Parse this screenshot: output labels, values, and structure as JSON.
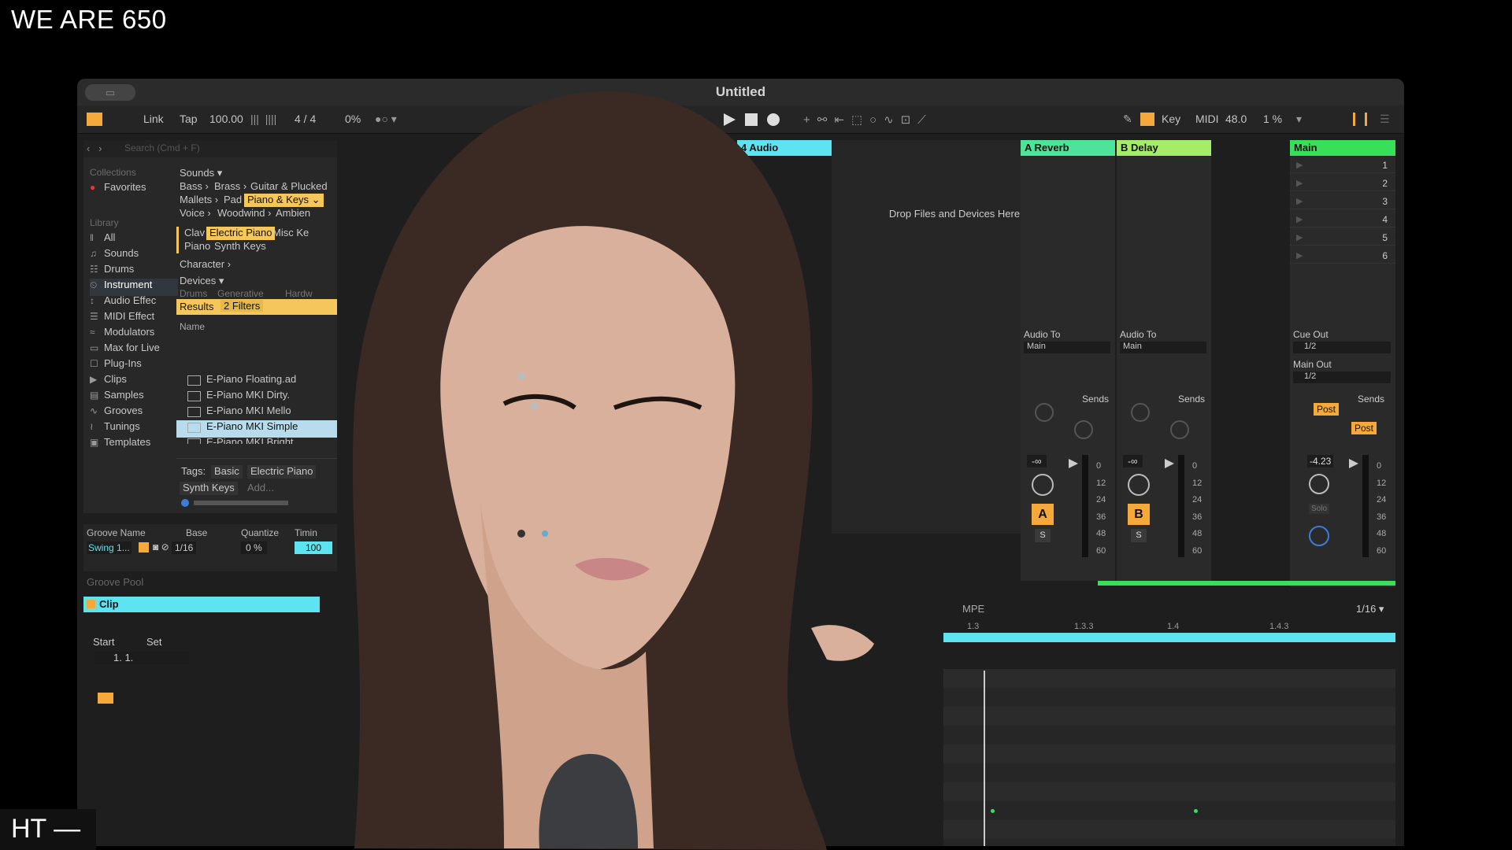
{
  "overlay": {
    "stream_title": "WE ARE 650",
    "corner_label": "HT —"
  },
  "window": {
    "title": "Untitled"
  },
  "controls": {
    "link": "Link",
    "tap": "Tap",
    "tempo": "100.00",
    "time_sig": "4  /  4",
    "groove_pct": "0%",
    "bar_readout": "4",
    "key": "Key",
    "midi": "MIDI",
    "cpu": "48.0",
    "cpu_pct": "1 %"
  },
  "browser": {
    "search_placeholder": "Search (Cmd + F)",
    "collections_label": "Collections",
    "favorites": "Favorites",
    "library_label": "Library",
    "library_items": [
      {
        "icon": "all-icon",
        "glyph": "‖",
        "label": "All"
      },
      {
        "icon": "sounds-icon",
        "glyph": "♫",
        "label": "Sounds"
      },
      {
        "icon": "drums-icon",
        "glyph": "☷",
        "label": "Drums"
      },
      {
        "icon": "instruments-icon",
        "glyph": "⏲",
        "label": "Instrument"
      },
      {
        "icon": "audio-effects-icon",
        "glyph": "↕",
        "label": "Audio Effec"
      },
      {
        "icon": "midi-effects-icon",
        "glyph": "☰",
        "label": "MIDI Effect"
      },
      {
        "icon": "modulators-icon",
        "glyph": "≈",
        "label": "Modulators"
      },
      {
        "icon": "max-for-live-icon",
        "glyph": "▭",
        "label": "Max for Live"
      },
      {
        "icon": "plug-ins-icon",
        "glyph": "☐",
        "label": "Plug-Ins"
      },
      {
        "icon": "clips-icon",
        "glyph": "▶",
        "label": "Clips"
      },
      {
        "icon": "samples-icon",
        "glyph": "▤",
        "label": "Samples"
      },
      {
        "icon": "grooves-icon",
        "glyph": "∿",
        "label": "Grooves"
      },
      {
        "icon": "tunings-icon",
        "glyph": "≀",
        "label": "Tunings"
      },
      {
        "icon": "templates-icon",
        "glyph": "▣",
        "label": "Templates"
      }
    ],
    "sounds_label": "Sounds ▾",
    "sound_cats": {
      "r1": [
        "Bass ›",
        "Brass ›",
        "Guitar & Plucked"
      ],
      "r2": [
        "Mallets ›",
        "Pad",
        "Piano & Keys ⌄"
      ],
      "r3": [
        "Voice ›",
        "Woodwind ›",
        "Ambien"
      ],
      "r4": [
        "Clav",
        "Electric Piano",
        "Misc Ke"
      ],
      "r5": [
        "Piano",
        "Synth Keys"
      ]
    },
    "character_label": "Character ›",
    "devices_label": "Devices ▾",
    "devices_sub": [
      "Drums",
      "Generative",
      "Hardw"
    ],
    "results_label": "Results",
    "filters_label": "2 Filters",
    "name_col": "Name",
    "results": [
      "E-Piano Floating.ad",
      "E-Piano MKI Dirty.",
      "E-Piano MKI Mello",
      "E-Piano MKI Simple",
      "E-Piano MKI Bright"
    ],
    "tags_label": "Tags:",
    "tags": [
      "Basic",
      "Electric Piano",
      "Synth Keys"
    ],
    "add_tag": "Add..."
  },
  "groove": {
    "headers": [
      "Groove Name",
      "Base",
      "Quantize",
      "Timin"
    ],
    "name": "Swing 1...",
    "base": "1/16",
    "quantize": "0 %",
    "timing": "100",
    "pool_label": "Groove Pool"
  },
  "session": {
    "track4": "4 Audio",
    "drop_hint": "Drop Files and Devices Here",
    "returns": [
      {
        "name": "A Reverb",
        "color": "#4de39a",
        "letter": "A",
        "audio_to_label": "Audio To",
        "audio_to": "Main",
        "vol": "-∞"
      },
      {
        "name": "B Delay",
        "color": "#a6ec6b",
        "letter": "B",
        "audio_to_label": "Audio To",
        "audio_to": "Main",
        "vol": "-∞"
      }
    ],
    "main": {
      "name": "Main",
      "color": "#38e05a",
      "vol": "-4.23",
      "cue_out_label": "Cue Out",
      "cue_out": "1/2",
      "main_out_label": "Main Out",
      "main_out": "1/2",
      "solo": "Solo"
    },
    "scenes": [
      "1",
      "2",
      "3",
      "4",
      "5",
      "6"
    ],
    "sends_label": "Sends",
    "post": "Post",
    "s_label": "S",
    "meter_scale": [
      "0",
      "12",
      "24",
      "36",
      "48",
      "60"
    ]
  },
  "clip": {
    "title": "Clip",
    "start_label": "Start",
    "set_label": "Set",
    "start_value": "1.  1.",
    "mpe": "MPE",
    "grid": "1/16 ▾",
    "ruler": [
      "1.3",
      "1.3.3",
      "1.4",
      "1.4.3"
    ]
  },
  "colors": {
    "accent_orange": "#f5a93a",
    "accent_cyan": "#5ee4f0",
    "highlight_yellow": "#f5c65a"
  }
}
